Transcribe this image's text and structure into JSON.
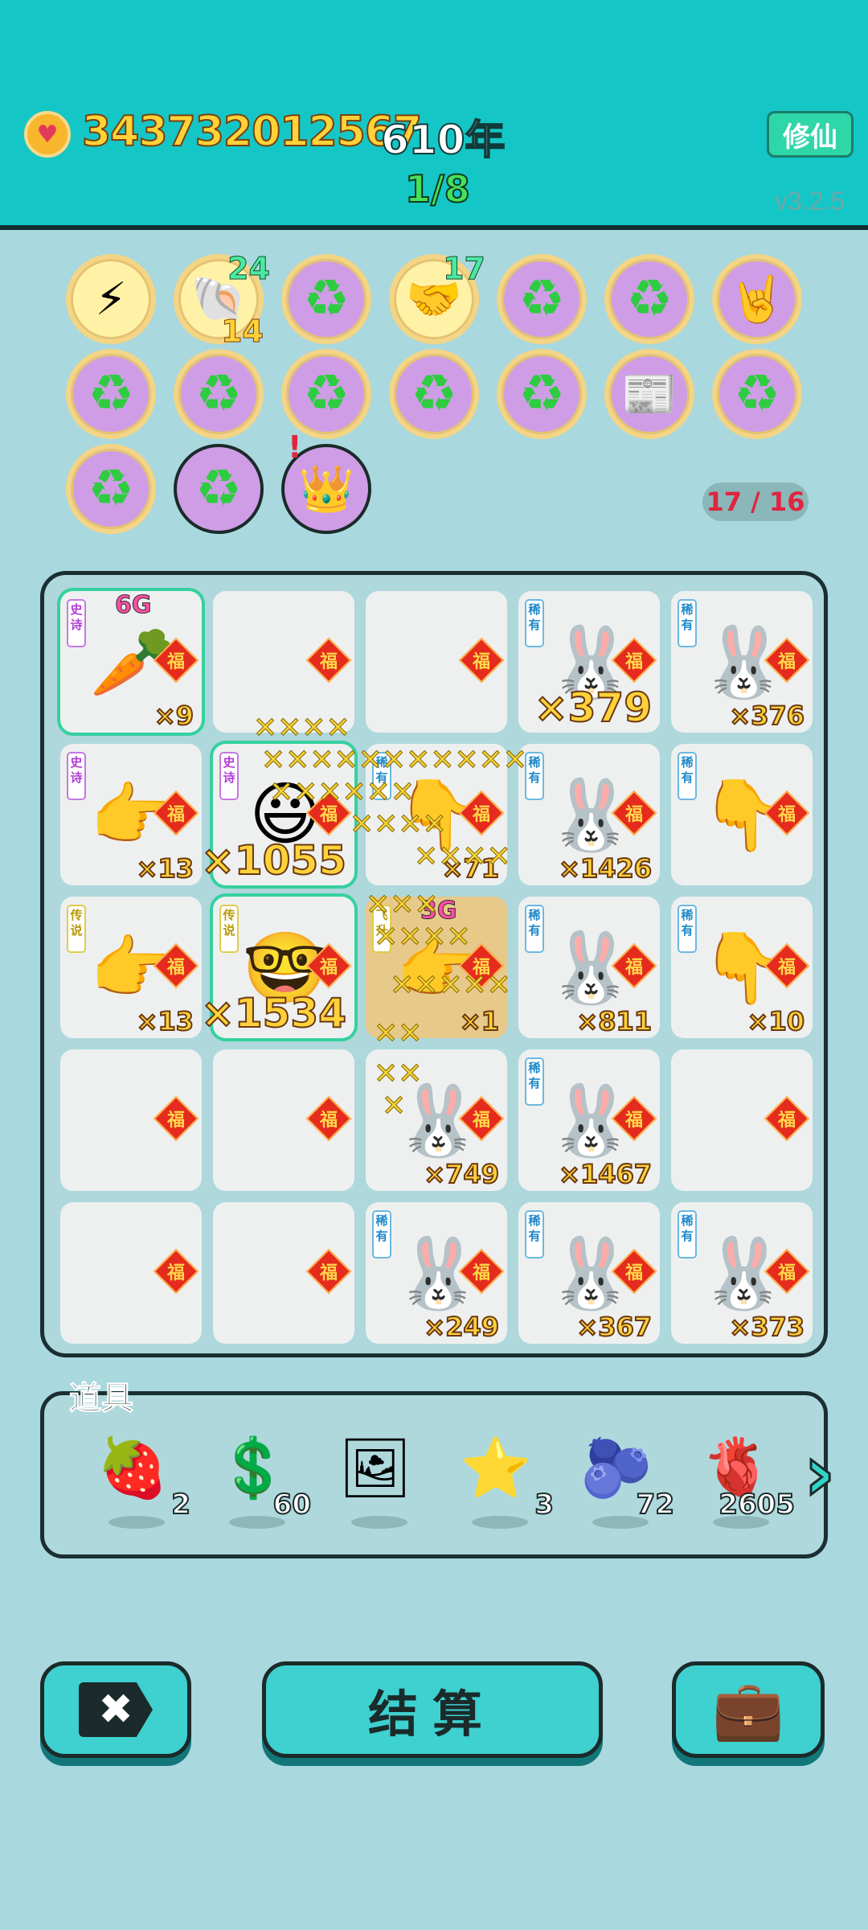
{
  "header": {
    "coins": "343732012567",
    "year": "610年",
    "progress": "1/8",
    "cultivate_button": "修仙",
    "version": "v3.2.5"
  },
  "relics": {
    "count": "17 / 16",
    "items": [
      {
        "name": "lightning-pin-icon",
        "glyph": "⚡"
      },
      {
        "name": "shell-icon",
        "glyph": "🐚",
        "top": "24",
        "bottom": "14"
      },
      {
        "name": "recycle-icon",
        "glyph": "♻"
      },
      {
        "name": "handshake-icon",
        "glyph": "🤝",
        "top": "17"
      },
      {
        "name": "recycle-icon",
        "glyph": "♻"
      },
      {
        "name": "recycle-icon",
        "glyph": "♻"
      },
      {
        "name": "rock-hand-icon",
        "glyph": "🤘"
      },
      {
        "name": "recycle-icon",
        "glyph": "♻"
      },
      {
        "name": "recycle-icon",
        "glyph": "♻"
      },
      {
        "name": "recycle-icon",
        "glyph": "♻"
      },
      {
        "name": "recycle-icon",
        "glyph": "♻"
      },
      {
        "name": "recycle-icon",
        "glyph": "♻"
      },
      {
        "name": "time-magazine-icon",
        "glyph": "📰"
      },
      {
        "name": "recycle-icon",
        "glyph": "♻"
      },
      {
        "name": "recycle-icon",
        "glyph": "♻"
      },
      {
        "name": "recycle-icon",
        "glyph": "♻"
      },
      {
        "name": "crown-box-icon",
        "glyph": "👑"
      }
    ]
  },
  "board": {
    "fu": "福",
    "cells": [
      {
        "tag": "史诗",
        "tag_type": "epic",
        "g": "6G",
        "icon": "carrot-icon",
        "glyph": "🥕",
        "mult": "×9",
        "size": "s",
        "sel": true
      },
      {
        "icon": "empty"
      },
      {
        "icon": "empty"
      },
      {
        "tag": "稀有",
        "tag_type": "rare",
        "icon": "rabbit-icon",
        "glyph": "🐰",
        "mult": "×379",
        "size": "l"
      },
      {
        "tag": "稀有",
        "tag_type": "rare",
        "icon": "rabbit-icon",
        "glyph": "🐰",
        "mult": "×376",
        "size": "s"
      },
      {
        "tag": "史诗",
        "tag_type": "epic",
        "icon": "gray-hand-icon",
        "glyph": "👉",
        "mult": "×13",
        "size": "s"
      },
      {
        "tag": "史诗",
        "tag_type": "epic",
        "icon": "face-icon",
        "glyph": "😃",
        "mult": "×1055",
        "size": "l",
        "sel": true
      },
      {
        "tag": "稀有",
        "tag_type": "rare",
        "icon": "brown-hand-icon",
        "glyph": "👇",
        "mult": "×71",
        "size": "s"
      },
      {
        "tag": "稀有",
        "tag_type": "rare",
        "icon": "rabbit-icon",
        "glyph": "🐰",
        "mult": "×1426",
        "size": "s"
      },
      {
        "tag": "稀有",
        "tag_type": "rare",
        "icon": "brown-hand-icon",
        "glyph": "👇",
        "mult": "",
        "size": "s"
      },
      {
        "tag": "传说",
        "tag_type": "legend",
        "icon": "yellow-hand-icon",
        "glyph": "👉",
        "mult": "×13",
        "size": "s"
      },
      {
        "tag": "传说",
        "tag_type": "legend",
        "icon": "glasses-man-icon",
        "glyph": "🤓",
        "mult": "×1534",
        "size": "l",
        "sel": true
      },
      {
        "tag": "飞升",
        "tag_type": "legend",
        "g": "3G",
        "icon": "yellow-hand-icon",
        "glyph": "👉",
        "mult": "×1",
        "size": "s",
        "hl": true
      },
      {
        "tag": "稀有",
        "tag_type": "rare",
        "icon": "rabbit-icon",
        "glyph": "🐰",
        "mult": "×811",
        "size": "s"
      },
      {
        "tag": "稀有",
        "tag_type": "rare",
        "icon": "brown-hand-icon",
        "glyph": "👇",
        "mult": "×10",
        "size": "s"
      },
      {
        "icon": "empty"
      },
      {
        "icon": "empty"
      },
      {
        "icon": "rabbit-icon",
        "glyph": "🐰",
        "mult": "×749",
        "size": "s"
      },
      {
        "tag": "稀有",
        "tag_type": "rare",
        "icon": "rabbit-icon",
        "glyph": "🐰",
        "mult": "×1467",
        "size": "s"
      },
      {
        "icon": "empty"
      },
      {
        "icon": "empty"
      },
      {
        "icon": "empty"
      },
      {
        "tag": "稀有",
        "tag_type": "rare",
        "icon": "rabbit-icon",
        "glyph": "🐰",
        "mult": "×249",
        "size": "s"
      },
      {
        "tag": "稀有",
        "tag_type": "rare",
        "icon": "rabbit-icon",
        "glyph": "🐰",
        "mult": "×367",
        "size": "s"
      },
      {
        "tag": "稀有",
        "tag_type": "rare",
        "icon": "rabbit-icon",
        "glyph": "🐰",
        "mult": "×373",
        "size": "s"
      }
    ]
  },
  "items_panel": {
    "title": "道具",
    "items": [
      {
        "name": "lychee-icon",
        "glyph": "🍓",
        "count": "2"
      },
      {
        "name": "dollar-coin-icon",
        "glyph": "💲",
        "count": "60"
      },
      {
        "name": "portrait-frame-icon",
        "glyph": "🖼",
        "count": ""
      },
      {
        "name": "star-icon",
        "glyph": "⭐",
        "count": "3"
      },
      {
        "name": "blueberry-icon",
        "glyph": "🫐",
        "count": "72"
      },
      {
        "name": "liver-icon",
        "glyph": "🫀",
        "count": "2605"
      }
    ]
  },
  "buttons": {
    "settle_label": "结算",
    "close_glyph": "✖",
    "bag_glyph": "💼"
  },
  "colors": {
    "topbar": "#15c6c6",
    "background": "#a9d8de",
    "coin_text": "#ffd23a",
    "fu_diamond": "#e52b1e"
  }
}
